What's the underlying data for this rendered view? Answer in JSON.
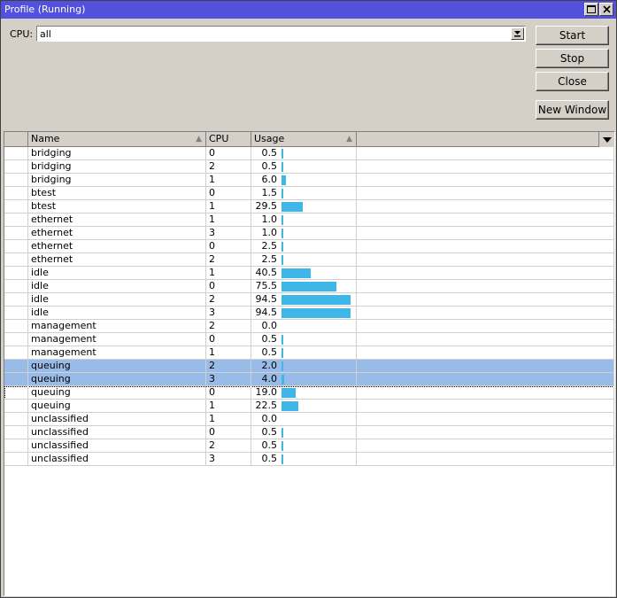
{
  "window": {
    "title": "Profile (Running)"
  },
  "cpu": {
    "label": "CPU:",
    "value": "all"
  },
  "buttons": {
    "start": "Start",
    "stop": "Stop",
    "close": "Close",
    "new_window": "New Window"
  },
  "columns": {
    "name": "Name",
    "cpu": "CPU",
    "usage": "Usage"
  },
  "colors": {
    "accent": "#5151dd",
    "bar": "#3fb6ea",
    "selection": "#99bbe8"
  },
  "rows": [
    {
      "name": "bridging",
      "cpu": "0",
      "usage": "0.5"
    },
    {
      "name": "bridging",
      "cpu": "2",
      "usage": "0.5"
    },
    {
      "name": "bridging",
      "cpu": "1",
      "usage": "6.0"
    },
    {
      "name": "btest",
      "cpu": "0",
      "usage": "1.5"
    },
    {
      "name": "btest",
      "cpu": "1",
      "usage": "29.5"
    },
    {
      "name": "ethernet",
      "cpu": "1",
      "usage": "1.0"
    },
    {
      "name": "ethernet",
      "cpu": "3",
      "usage": "1.0"
    },
    {
      "name": "ethernet",
      "cpu": "0",
      "usage": "2.5"
    },
    {
      "name": "ethernet",
      "cpu": "2",
      "usage": "2.5"
    },
    {
      "name": "idle",
      "cpu": "1",
      "usage": "40.5"
    },
    {
      "name": "idle",
      "cpu": "0",
      "usage": "75.5"
    },
    {
      "name": "idle",
      "cpu": "2",
      "usage": "94.5"
    },
    {
      "name": "idle",
      "cpu": "3",
      "usage": "94.5"
    },
    {
      "name": "management",
      "cpu": "2",
      "usage": "0.0"
    },
    {
      "name": "management",
      "cpu": "0",
      "usage": "0.5"
    },
    {
      "name": "management",
      "cpu": "1",
      "usage": "0.5"
    },
    {
      "name": "queuing",
      "cpu": "2",
      "usage": "2.0",
      "selected": true
    },
    {
      "name": "queuing",
      "cpu": "3",
      "usage": "4.0",
      "selected": true
    },
    {
      "name": "queuing",
      "cpu": "0",
      "usage": "19.0",
      "focused": true
    },
    {
      "name": "queuing",
      "cpu": "1",
      "usage": "22.5"
    },
    {
      "name": "unclassified",
      "cpu": "1",
      "usage": "0.0"
    },
    {
      "name": "unclassified",
      "cpu": "0",
      "usage": "0.5"
    },
    {
      "name": "unclassified",
      "cpu": "2",
      "usage": "0.5"
    },
    {
      "name": "unclassified",
      "cpu": "3",
      "usage": "0.5"
    }
  ]
}
